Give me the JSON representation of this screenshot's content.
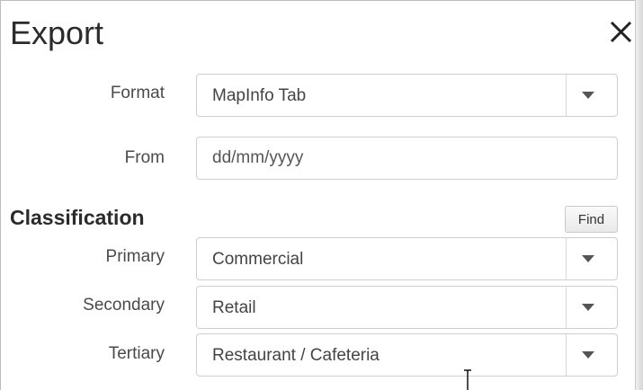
{
  "dialog": {
    "title": "Export",
    "close_icon": "close-icon"
  },
  "format": {
    "label": "Format",
    "selected": "MapInfo Tab"
  },
  "from": {
    "label": "From",
    "placeholder": "dd/mm/yyyy",
    "value": ""
  },
  "classification": {
    "heading": "Classification",
    "find_label": "Find",
    "primary": {
      "label": "Primary",
      "selected": "Commercial"
    },
    "secondary": {
      "label": "Secondary",
      "selected": "Retail"
    },
    "tertiary": {
      "label": "Tertiary",
      "selected": "Restaurant / Cafeteria"
    }
  },
  "icons": {
    "dropdown": "chevron-down-icon",
    "cursor": "text-cursor-icon"
  }
}
